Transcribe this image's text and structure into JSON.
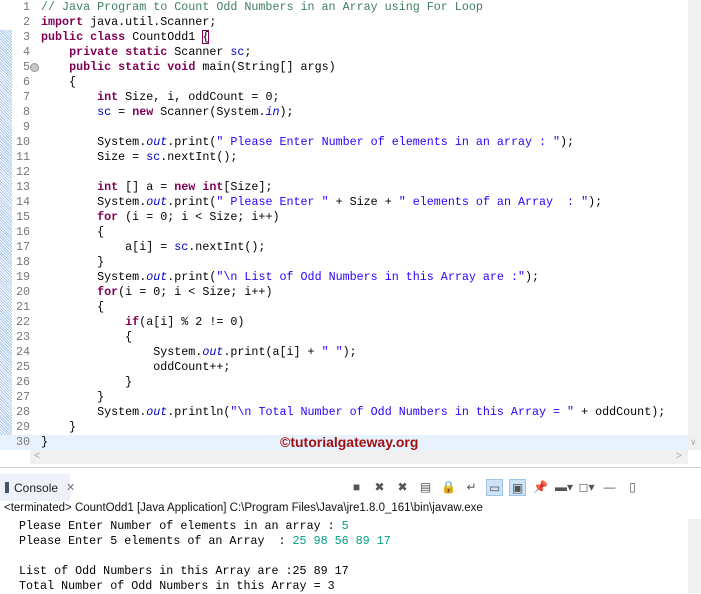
{
  "editor": {
    "lines": [
      [
        [
          "c",
          "// Java Program to Count Odd Numbers in an Array using For Loop"
        ]
      ],
      [
        [
          "k",
          "import"
        ],
        [
          "p",
          " java.util.Scanner;"
        ]
      ],
      [
        [
          "k",
          "public"
        ],
        [
          "p",
          " "
        ],
        [
          "k",
          "class"
        ],
        [
          "p",
          " CountOdd1 "
        ],
        [
          "b",
          "{"
        ]
      ],
      [
        [
          "p",
          "    "
        ],
        [
          "k",
          "private"
        ],
        [
          "p",
          " "
        ],
        [
          "k",
          "static"
        ],
        [
          "p",
          " Scanner "
        ],
        [
          "f",
          "sc"
        ],
        [
          "p",
          ";"
        ]
      ],
      [
        [
          "p",
          "    "
        ],
        [
          "k",
          "public"
        ],
        [
          "p",
          " "
        ],
        [
          "k",
          "static"
        ],
        [
          "p",
          " "
        ],
        [
          "k",
          "void"
        ],
        [
          "p",
          " main(String[] args)"
        ]
      ],
      [
        [
          "p",
          "    {"
        ]
      ],
      [
        [
          "p",
          "        "
        ],
        [
          "k",
          "int"
        ],
        [
          "p",
          " Size, i, oddCount = 0;"
        ]
      ],
      [
        [
          "p",
          "        "
        ],
        [
          "f",
          "sc"
        ],
        [
          "p",
          " = "
        ],
        [
          "k",
          "new"
        ],
        [
          "p",
          " Scanner(System."
        ],
        [
          "i",
          "in"
        ],
        [
          "p",
          ");"
        ]
      ],
      [],
      [
        [
          "p",
          "        System."
        ],
        [
          "i",
          "out"
        ],
        [
          "p",
          ".print("
        ],
        [
          "s",
          "\" Please Enter Number of elements in an array : \""
        ],
        [
          "p",
          ");"
        ]
      ],
      [
        [
          "p",
          "        Size = "
        ],
        [
          "f",
          "sc"
        ],
        [
          "p",
          ".nextInt();"
        ]
      ],
      [],
      [
        [
          "p",
          "        "
        ],
        [
          "k",
          "int"
        ],
        [
          "p",
          " [] a = "
        ],
        [
          "k",
          "new"
        ],
        [
          "p",
          " "
        ],
        [
          "k",
          "int"
        ],
        [
          "p",
          "[Size];"
        ]
      ],
      [
        [
          "p",
          "        System."
        ],
        [
          "i",
          "out"
        ],
        [
          "p",
          ".print("
        ],
        [
          "s",
          "\" Please Enter \""
        ],
        [
          "p",
          " + Size + "
        ],
        [
          "s",
          "\" elements of an Array  : \""
        ],
        [
          "p",
          ");"
        ]
      ],
      [
        [
          "p",
          "        "
        ],
        [
          "k",
          "for"
        ],
        [
          "p",
          " (i = 0; i < Size; i++)"
        ]
      ],
      [
        [
          "p",
          "        {"
        ]
      ],
      [
        [
          "p",
          "            a[i] = "
        ],
        [
          "f",
          "sc"
        ],
        [
          "p",
          ".nextInt();"
        ]
      ],
      [
        [
          "p",
          "        }"
        ]
      ],
      [
        [
          "p",
          "        System."
        ],
        [
          "i",
          "out"
        ],
        [
          "p",
          ".print("
        ],
        [
          "s",
          "\"\\n List of Odd Numbers in this Array are :\""
        ],
        [
          "p",
          ");"
        ]
      ],
      [
        [
          "p",
          "        "
        ],
        [
          "k",
          "for"
        ],
        [
          "p",
          "(i = 0; i < Size; i++)"
        ]
      ],
      [
        [
          "p",
          "        {"
        ]
      ],
      [
        [
          "p",
          "            "
        ],
        [
          "k",
          "if"
        ],
        [
          "p",
          "(a[i] % 2 != 0)"
        ]
      ],
      [
        [
          "p",
          "            {"
        ]
      ],
      [
        [
          "p",
          "                System."
        ],
        [
          "i",
          "out"
        ],
        [
          "p",
          ".print(a[i] + "
        ],
        [
          "s",
          "\" \""
        ],
        [
          "p",
          ");"
        ]
      ],
      [
        [
          "p",
          "                oddCount++;"
        ]
      ],
      [
        [
          "p",
          "            }"
        ]
      ],
      [
        [
          "p",
          "        }"
        ]
      ],
      [
        [
          "p",
          "        System."
        ],
        [
          "i",
          "out"
        ],
        [
          "p",
          ".println("
        ],
        [
          "s",
          "\"\\n Total Number of Odd Numbers in this Array = \""
        ],
        [
          "p",
          " + oddCount);"
        ]
      ],
      [
        [
          "p",
          "    }"
        ]
      ],
      [
        [
          "p",
          "}"
        ]
      ]
    ],
    "current_line": 30,
    "watermark": "©tutorialgateway.org"
  },
  "console": {
    "tab_label": "Console",
    "status": "<terminated> CountOdd1 [Java Application] C:\\Program Files\\Java\\jre1.8.0_161\\bin\\javaw.exe",
    "output": [
      {
        "text": " Please Enter Number of elements in an array : ",
        "input": "5"
      },
      {
        "text": " Please Enter 5 elements of an Array  : ",
        "input": "25 98 56 89 17"
      },
      {
        "text": "",
        "input": ""
      },
      {
        "text": " List of Odd Numbers in this Array are :25 89 17",
        "input": ""
      },
      {
        "text": " Total Number of Odd Numbers in this Array = 3",
        "input": ""
      }
    ],
    "toolbar": [
      "terminate-icon",
      "remove-launch-icon",
      "remove-all-terminated-icon",
      "clear-console-icon",
      "scroll-lock-icon",
      "word-wrap-icon",
      "show-on-stdout-icon",
      "show-on-stderr-icon",
      "pin-console-icon",
      "display-console-icon",
      "open-console-icon",
      "minimize-icon",
      "maximize-icon"
    ]
  }
}
